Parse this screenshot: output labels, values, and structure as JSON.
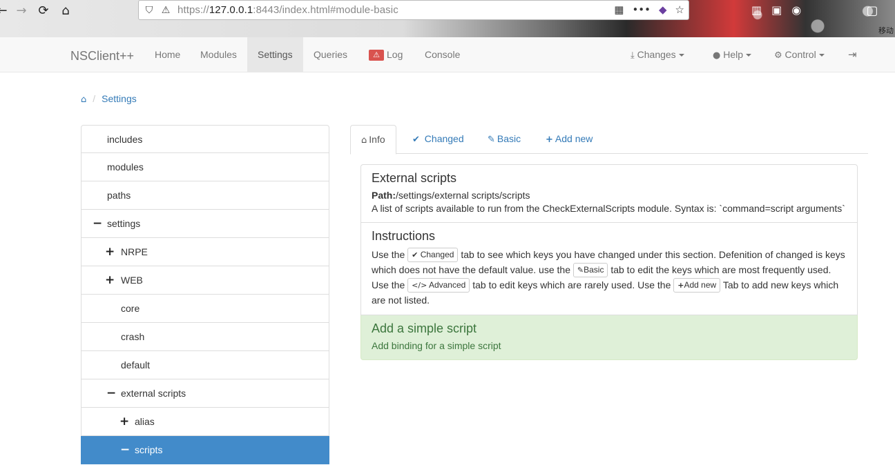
{
  "browser": {
    "url_prefix": "https://",
    "url_host": "127.0.0.1",
    "url_rest": ":8443/index.html#module-basic",
    "side_label": "移动"
  },
  "navbar": {
    "brand": "NSClient++",
    "items": [
      {
        "label": "Home"
      },
      {
        "label": "Modules"
      },
      {
        "label": "Settings"
      },
      {
        "label": "Queries"
      },
      {
        "label": "Log"
      },
      {
        "label": "Console"
      }
    ],
    "right": {
      "changes": "Changes",
      "help": "Help",
      "control": "Control"
    }
  },
  "breadcrumb": {
    "current": "Settings"
  },
  "tree": [
    {
      "label": "includes",
      "toggle": ""
    },
    {
      "label": "modules",
      "toggle": ""
    },
    {
      "label": "paths",
      "toggle": ""
    },
    {
      "label": "settings",
      "toggle": "−"
    },
    {
      "label": "NRPE",
      "toggle": "+"
    },
    {
      "label": "WEB",
      "toggle": "+"
    },
    {
      "label": "core",
      "toggle": ""
    },
    {
      "label": "crash",
      "toggle": ""
    },
    {
      "label": "default",
      "toggle": ""
    },
    {
      "label": "external scripts",
      "toggle": "−"
    },
    {
      "label": "alias",
      "toggle": "+"
    },
    {
      "label": "scripts",
      "toggle": "−"
    }
  ],
  "tabs": {
    "info": "Info",
    "changed": "Changed",
    "basic": "Basic",
    "add_new": "Add new"
  },
  "section": {
    "title": "External scripts",
    "path_label": "Path:",
    "path_value": "/settings/external scripts/scripts",
    "description": "A list of scripts available to run from the CheckExternalScripts module. Syntax is: `command=script arguments`"
  },
  "instructions": {
    "title": "Instructions",
    "t1": "Use the",
    "k_changed": "Changed",
    "t2": "tab to see which keys you have changed under this section. Defenition of changed is keys which does not have the default value. use the",
    "k_basic": "Basic",
    "t3": "tab to edit the keys which are most frequently used. Use the",
    "k_advanced": "Advanced",
    "t4": "tab to edit keys which are rarely used. Use the",
    "k_add_new": "Add new",
    "t5": "Tab to add new keys which are not listed."
  },
  "add_script": {
    "title": "Add a simple script",
    "subtitle": "Add binding for a simple script"
  },
  "colors": {
    "link": "#337ab7",
    "active_item": "#428bca",
    "success_bg": "#dff0d8",
    "success_text": "#3c763d",
    "danger": "#d9534f"
  }
}
